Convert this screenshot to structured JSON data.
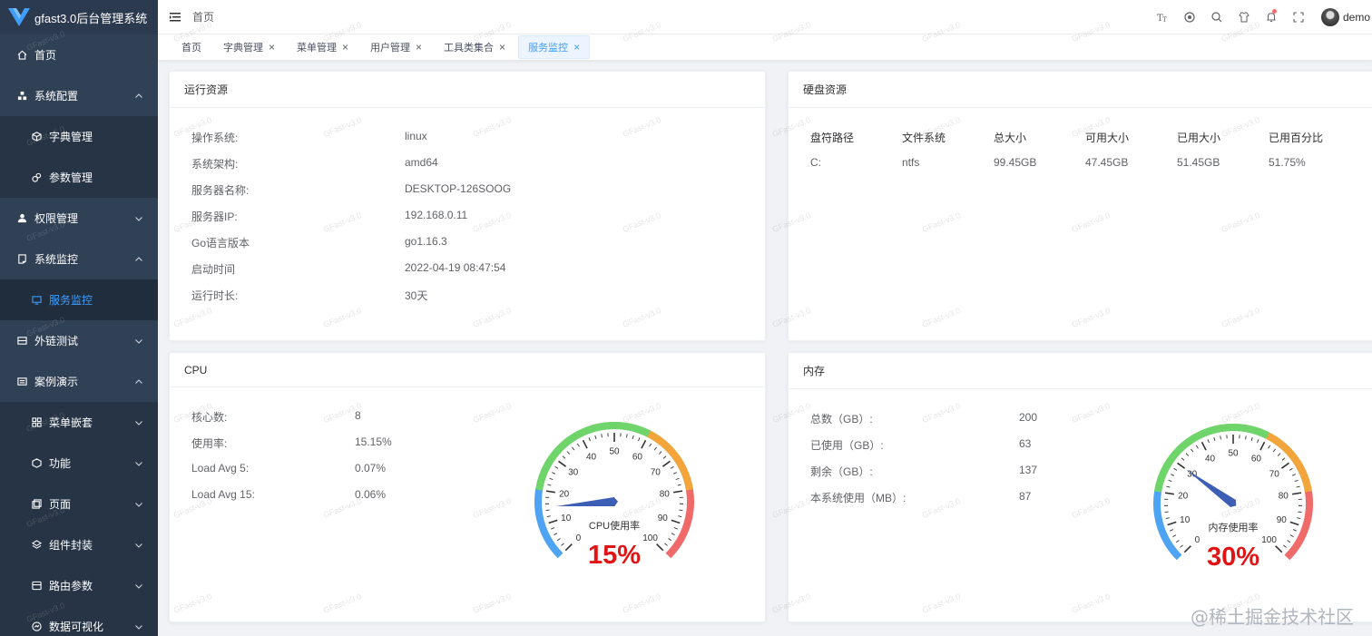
{
  "app": {
    "title": "gfast3.0后台管理系统",
    "watermark": "GFast-v3.0"
  },
  "sidebar": {
    "items": [
      {
        "label": "首页",
        "icon": "home-icon",
        "level": 1,
        "arrow": ""
      },
      {
        "label": "系统配置",
        "icon": "system-config-icon",
        "level": 1,
        "arrow": "up"
      },
      {
        "label": "字典管理",
        "icon": "cube-icon",
        "level": 2,
        "arrow": ""
      },
      {
        "label": "参数管理",
        "icon": "params-icon",
        "level": 2,
        "arrow": ""
      },
      {
        "label": "权限管理",
        "icon": "user-icon",
        "level": 1,
        "arrow": "down"
      },
      {
        "label": "系统监控",
        "icon": "monitor-icon",
        "level": 1,
        "arrow": "up"
      },
      {
        "label": "服务监控",
        "icon": "screen-icon",
        "level": 2,
        "arrow": "",
        "active": true
      },
      {
        "label": "外链测试",
        "icon": "link-icon",
        "level": 1,
        "arrow": "down"
      },
      {
        "label": "案例演示",
        "icon": "demo-icon",
        "level": 1,
        "arrow": "up"
      },
      {
        "label": "菜单嵌套",
        "icon": "nest-icon",
        "level": 2,
        "arrow": "down"
      },
      {
        "label": "功能",
        "icon": "function-icon",
        "level": 2,
        "arrow": "down"
      },
      {
        "label": "页面",
        "icon": "page-icon",
        "level": 2,
        "arrow": "down"
      },
      {
        "label": "组件封装",
        "icon": "component-icon",
        "level": 2,
        "arrow": "down"
      },
      {
        "label": "路由参数",
        "icon": "route-icon",
        "level": 2,
        "arrow": "down"
      },
      {
        "label": "数据可视化",
        "icon": "chart-icon",
        "level": 2,
        "arrow": "down"
      }
    ]
  },
  "header": {
    "breadcrumb": "首页",
    "tools": [
      "font-size-icon",
      "theme-icon",
      "search-icon",
      "skin-icon",
      "bell-icon",
      "fullscreen-icon"
    ],
    "username": "demo"
  },
  "tags": [
    {
      "label": "首页",
      "closable": false,
      "active": false
    },
    {
      "label": "字典管理",
      "closable": true,
      "active": false
    },
    {
      "label": "菜单管理",
      "closable": true,
      "active": false
    },
    {
      "label": "用户管理",
      "closable": true,
      "active": false
    },
    {
      "label": "工具类集合",
      "closable": true,
      "active": false
    },
    {
      "label": "服务监控",
      "closable": true,
      "active": true
    }
  ],
  "run": {
    "title": "运行资源",
    "rows": [
      {
        "k": "操作系统:",
        "v": "linux"
      },
      {
        "k": "系统架构:",
        "v": "amd64"
      },
      {
        "k": "服务器名称:",
        "v": "DESKTOP-126SOOG"
      },
      {
        "k": "服务器IP:",
        "v": "192.168.0.11"
      },
      {
        "k": "Go语言版本",
        "v": "go1.16.3"
      },
      {
        "k": "启动时间",
        "v": "2022-04-19 08:47:54"
      },
      {
        "k": "运行时长:",
        "v": "30天"
      }
    ]
  },
  "disk": {
    "title": "硬盘资源",
    "headers": [
      "盘符路径",
      "文件系统",
      "总大小",
      "可用大小",
      "已用大小",
      "已用百分比"
    ],
    "rows": [
      [
        "C:",
        "ntfs",
        "99.45GB",
        "47.45GB",
        "51.45GB",
        "51.75%"
      ]
    ]
  },
  "cpu": {
    "title": "CPU",
    "rows": [
      {
        "k": "核心数:",
        "v": "8"
      },
      {
        "k": "使用率:",
        "v": "15.15%"
      },
      {
        "k": "Load Avg 5:",
        "v": "0.07%"
      },
      {
        "k": "Load Avg 15:",
        "v": "0.06%"
      }
    ],
    "gauge": {
      "label": "CPU使用率",
      "value": 15,
      "display": "15%"
    }
  },
  "mem": {
    "title": "内存",
    "rows": [
      {
        "k": "总数（GB）:",
        "v": "200"
      },
      {
        "k": "已使用（GB）:",
        "v": "63"
      },
      {
        "k": "剩余（GB）:",
        "v": "137"
      },
      {
        "k": "本系统使用（MB）:",
        "v": "87"
      }
    ],
    "gauge": {
      "label": "内存使用率",
      "value": 30,
      "display": "30%"
    }
  },
  "gauge_ticks": [
    "0",
    "10",
    "20",
    "30",
    "40",
    "50",
    "60",
    "70",
    "80",
    "90",
    "100"
  ],
  "colors": {
    "blue": "#4ea4f3",
    "green": "#6fd46a",
    "orange": "#f3a43b",
    "red": "#f06a6a",
    "pointer": "#3d5eb5",
    "value": "#e01414",
    "accent": "#409eff"
  },
  "footer": {
    "juejin": "@稀土掘金技术社区"
  }
}
